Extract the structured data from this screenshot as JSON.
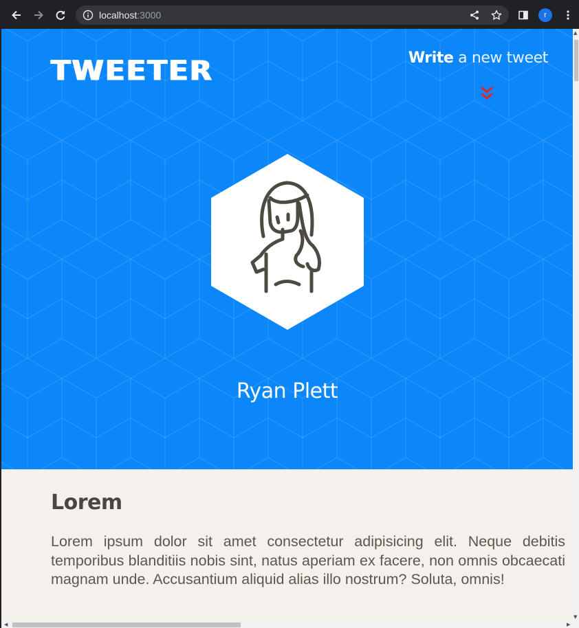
{
  "browser": {
    "url_host": "localhost",
    "url_port": ":3000",
    "profile_initial": "r"
  },
  "header": {
    "logo": "TWEETER",
    "compose_bold": "Write",
    "compose_rest": " a new tweet"
  },
  "profile": {
    "name": "Ryan Plett"
  },
  "article": {
    "title": "Lorem",
    "body": "Lorem ipsum dolor sit amet consectetur adipisicing elit. Neque debitis temporibus blanditiis nobis sint, natus aperiam ex facere, non omnis obcaecati magnam unde. Accusantium aliquid alias illo nostrum? Soluta, omnis!"
  },
  "colors": {
    "hero": "#0b87fa",
    "page_bg": "#f4f1ec",
    "arrow": "#e0262a",
    "avatar_line": "#4d4a42"
  }
}
